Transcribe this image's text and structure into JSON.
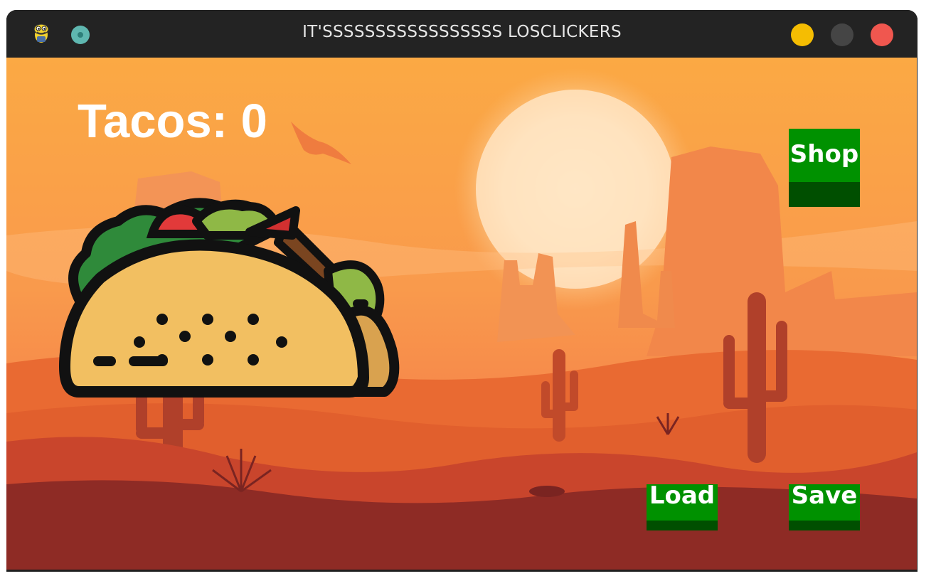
{
  "window": {
    "title": "IT'SSSSSSSSSSSSSSSSS LOSCLICKERS",
    "controls": {
      "minimize_color": "#f5bd02",
      "maximize_color": "#454545",
      "close_color": "#f0574f"
    },
    "app_icon": "python-snake-icon",
    "pin_icon": "pin-icon"
  },
  "game": {
    "score_label": "Tacos: 0",
    "taco_icon": "taco-icon",
    "background": "desert-sunset-scene",
    "buttons": {
      "shop": "Shop",
      "load": "Load",
      "save": "Save"
    },
    "colors": {
      "button_green": "#009100",
      "button_shade": "#004f00"
    }
  }
}
